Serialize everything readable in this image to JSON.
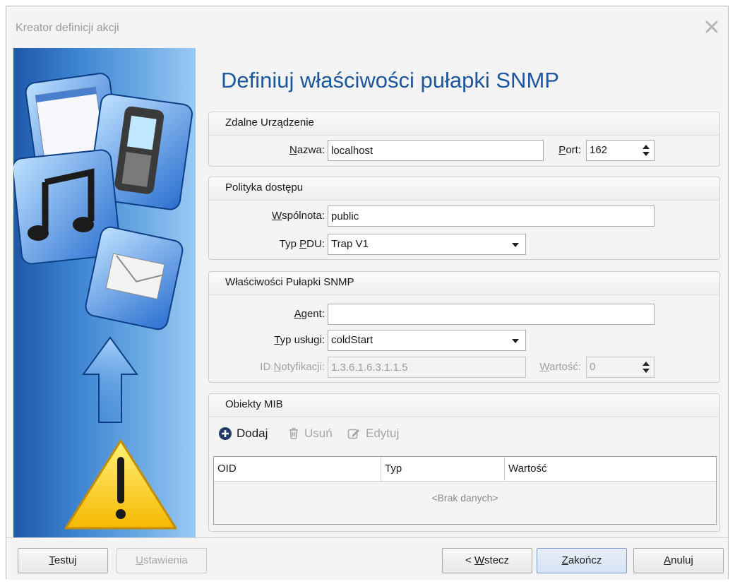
{
  "window": {
    "title": "Kreator definicji akcji"
  },
  "page": {
    "heading": "Definiuj właściwości pułapki SNMP"
  },
  "remote_device": {
    "title": "Zdalne Urządzenie",
    "name_label_mn": "N",
    "name_label_rest": "azwa:",
    "name_value": "localhost",
    "port_label_mn": "P",
    "port_label_rest": "ort:",
    "port_value": "162"
  },
  "access_policy": {
    "title": "Polityka dostępu",
    "community_label_mn": "W",
    "community_label_rest": "spólnota:",
    "community_value": "public",
    "pdu_label_pre": "Typ ",
    "pdu_label_mn": "P",
    "pdu_label_rest": "DU:",
    "pdu_value": "Trap V1"
  },
  "trap_properties": {
    "title": "Właściwości Pułapki SNMP",
    "agent_label_mn": "A",
    "agent_label_rest": "gent:",
    "agent_value": "",
    "service_label_mn": "T",
    "service_label_rest": "yp usługi:",
    "service_value": "coldStart",
    "notif_label_pre": "ID ",
    "notif_label_mn": "N",
    "notif_label_rest": "otyfikacji:",
    "notif_value": "1.3.6.1.6.3.1.1.5",
    "value_label_mn": "W",
    "value_label_rest": "artość:",
    "value_value": "0"
  },
  "mib": {
    "title": "Obiekty MIB",
    "add_label": "Dodaj",
    "remove_label": "Usuń",
    "edit_label": "Edytuj",
    "columns": [
      "OID",
      "Typ",
      "Wartość"
    ],
    "empty_text": "<Brak danych>"
  },
  "footer": {
    "test_mn": "T",
    "test_rest": "estuj",
    "settings_mn": "U",
    "settings_rest": "stawienia",
    "back_pre": "< ",
    "back_mn": "W",
    "back_rest": "stecz",
    "finish_mn": "Z",
    "finish_rest": "akończ",
    "cancel_mn": "A",
    "cancel_rest": "nuluj"
  },
  "colors": {
    "heading": "#1c57a0",
    "accent_blue": "#1e58a7",
    "disabled_text": "#a0a0a0"
  },
  "icons": [
    "close-icon",
    "plus-circle-icon",
    "trash-icon",
    "edit-icon",
    "clipboard-window-icon",
    "mobile-phone-icon",
    "music-note-icon",
    "envelope-icon",
    "arrow-up-icon",
    "warning-triangle-icon"
  ]
}
